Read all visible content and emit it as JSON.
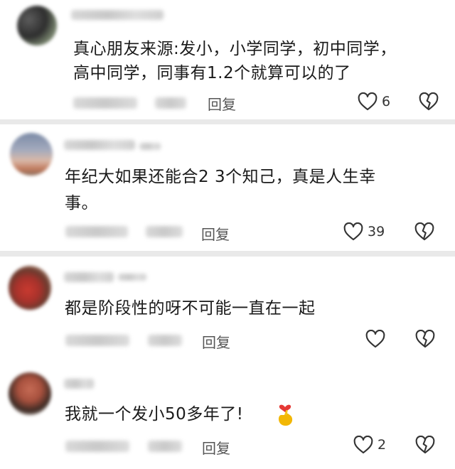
{
  "comments": [
    {
      "text_lines": [
        "真心朋友来源:发小，小学同学，初中同学，",
        "高中同学，同事有1.2个就算可以的了"
      ],
      "reply_label": "回复",
      "like_count": "6",
      "icons": {
        "like": "heart-outline-icon",
        "dislike": "broken-heart-icon"
      }
    },
    {
      "text_lines": [
        "年纪大如果还能合2  3个知己，真是人生幸",
        "事。"
      ],
      "reply_label": "回复",
      "like_count": "39",
      "icons": {
        "like": "heart-outline-icon",
        "dislike": "broken-heart-icon"
      }
    },
    {
      "text_lines": [
        "都是阶段性的呀不可能一直在一起"
      ],
      "reply_label": "回复",
      "like_count": "",
      "icons": {
        "like": "heart-outline-icon",
        "dislike": "broken-heart-icon"
      }
    },
    {
      "text_lines": [
        "我就一个发小50多年了!"
      ],
      "reply_label": "回复",
      "like_count": "2",
      "icons": {
        "like": "heart-outline-icon",
        "dislike": "broken-heart-icon",
        "emoji": "finger-heart-emoji"
      }
    }
  ],
  "colors": {
    "separator": "#e9e9e9",
    "text": "#1a1a1a",
    "muted": "#555555",
    "icon": "#333333",
    "emoji": "#f2b705"
  }
}
